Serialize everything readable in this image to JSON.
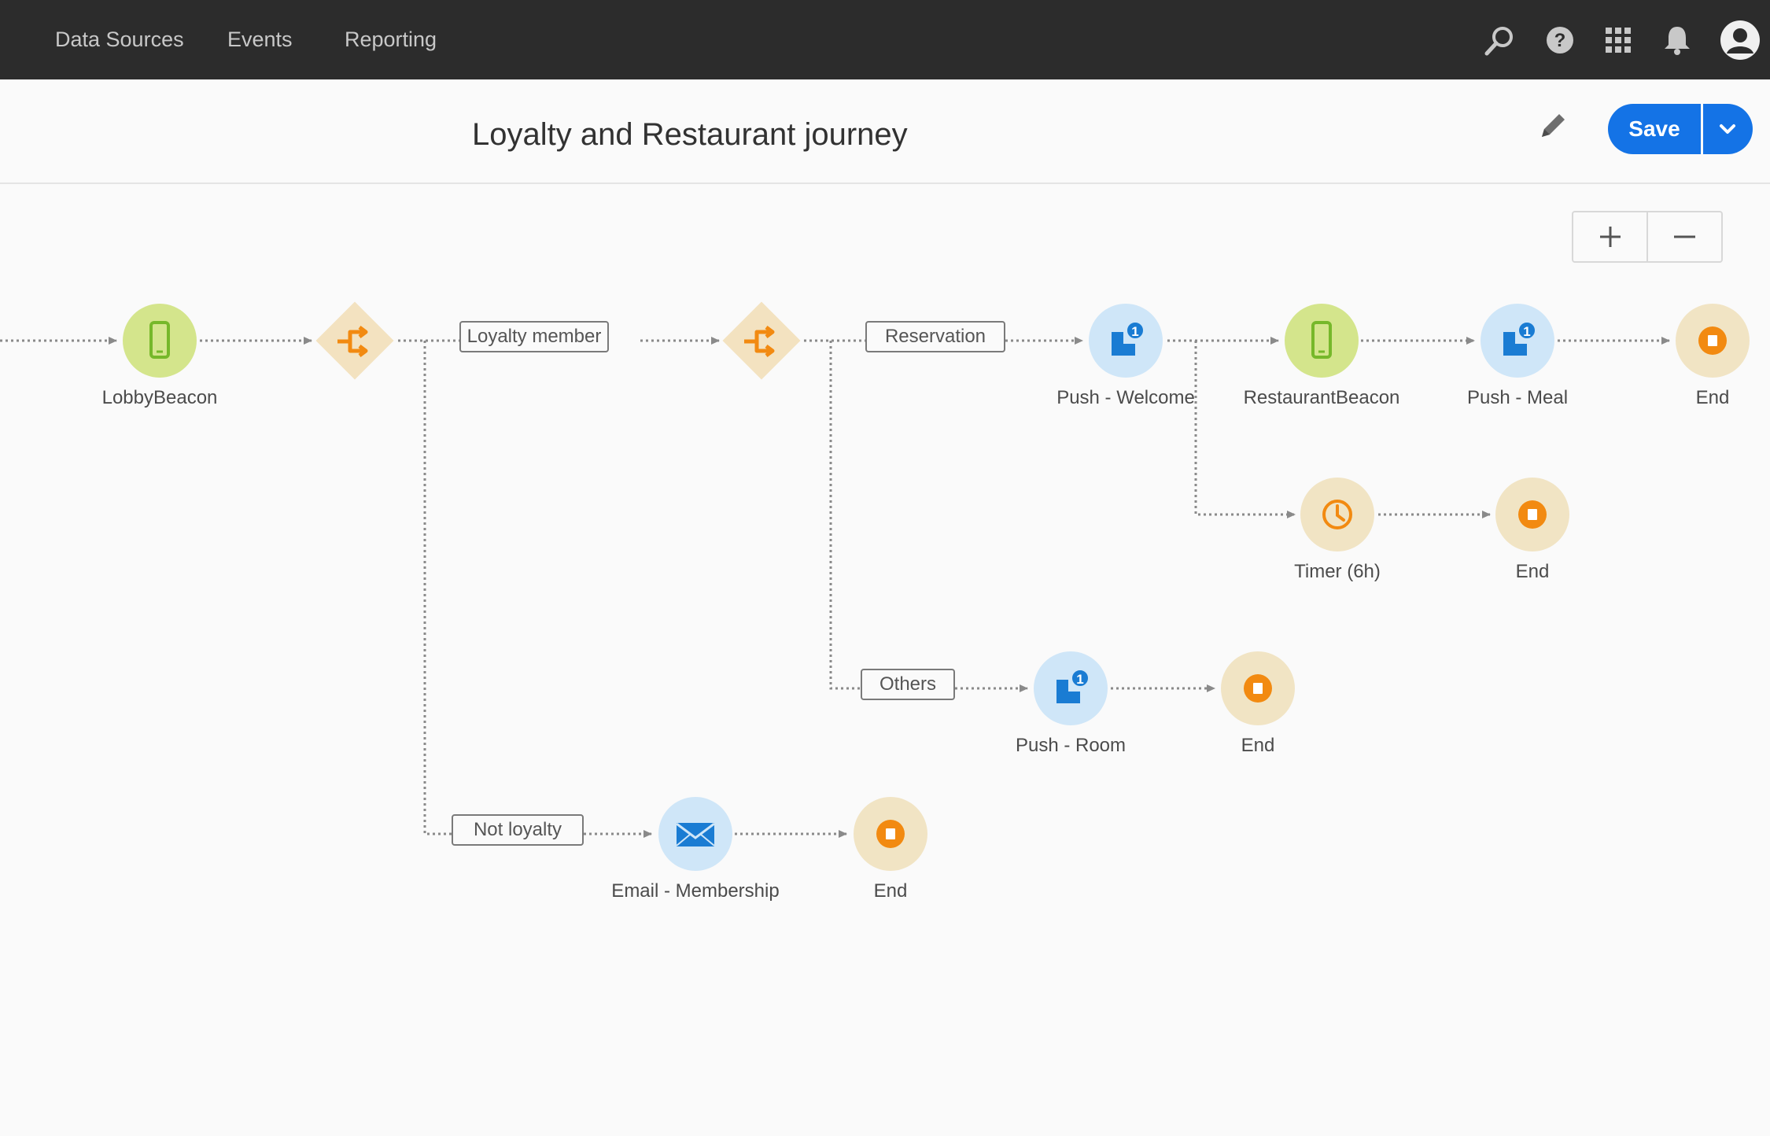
{
  "nav": {
    "items": [
      "Data Sources",
      "Events",
      "Reporting"
    ],
    "icons": [
      "search-icon",
      "help-icon",
      "apps-grid-icon",
      "bell-icon",
      "user-avatar-icon"
    ]
  },
  "header": {
    "title": "Loyalty and Restaurant journey",
    "save_label": "Save"
  },
  "zoom": {
    "plus": "+",
    "minus": "−"
  },
  "colors": {
    "nav_bg": "#2c2c2c",
    "accent": "#1473e6",
    "event_node": "#d4e58c",
    "action_node": "#cfe6f8",
    "end_node": "#f1e4c4",
    "condition": "#f3e2c0",
    "orange": "#f28a11"
  },
  "journey": {
    "branches": {
      "loyalty_member": "Loyalty member",
      "reservation": "Reservation",
      "others": "Others",
      "not_loyalty": "Not loyalty"
    },
    "nodes": {
      "lobby_beacon": "LobbyBeacon",
      "push_welcome": "Push - Welcome",
      "restaurant_beacon": "RestaurantBeacon",
      "push_meal": "Push - Meal",
      "end_main": "End",
      "timer": "Timer (6h)",
      "end_timer": "End",
      "push_room": "Push - Room",
      "end_room": "End",
      "email_membership": "Email - Membership",
      "end_email": "End"
    },
    "badge": "1"
  }
}
